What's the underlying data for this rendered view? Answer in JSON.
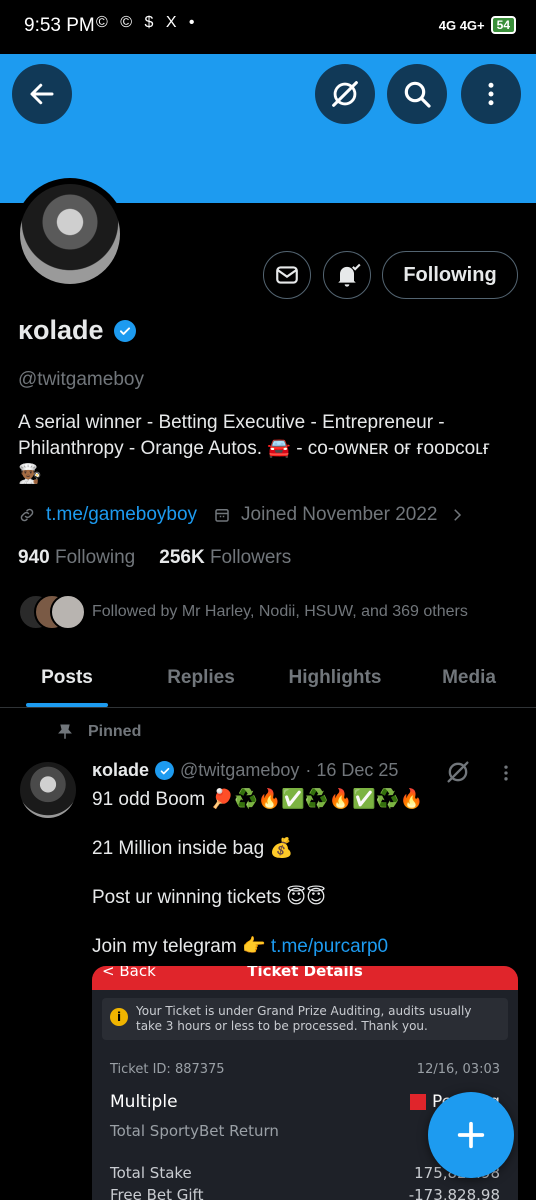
{
  "status": {
    "time": "9:53 PM",
    "app_icons": "© © $ X •",
    "network": "4G 4G+",
    "battery": "54"
  },
  "header": {
    "back_icon": "arrow-left-icon",
    "grok_icon": "slashed-circle-icon",
    "search_icon": "search-icon",
    "more_icon": "more-vertical-icon",
    "banner_color": "#1d9bf0"
  },
  "profile": {
    "name": "ĸolade",
    "handle": "@twitgameboy",
    "bio": "A serial winner - Betting Executive - Entrepreneur - Philanthropy - Orange Autos. 🚘 - ᴄᴏ-ᴏᴡɴᴇʀ ᴏғ ғᴏᴏᴅᴄᴏʟғ 👨🏾‍🍳",
    "link": "t.me/gameboyboy",
    "joined": "Joined November 2022",
    "following_count": "940",
    "following_label": "Following",
    "followers_count": "256K",
    "followers_label": "Followers",
    "followed_by": "Followed by Mr Harley, Nodii, HSUW, and 369 others",
    "follow_button": "Following"
  },
  "tabs": [
    "Posts",
    "Replies",
    "Highlights",
    "Media"
  ],
  "post": {
    "pinned_label": "Pinned",
    "name": "ĸolade",
    "handle": "@twitgameboy",
    "date": "· 16 Dec 25",
    "line1": "91 odd Boom 🏓♻️🔥✅♻️🔥✅♻️🔥",
    "line2": "21 Million inside bag 💰",
    "line3": "Post ur winning tickets 😇😇",
    "line4_prefix": "Join my telegram 👉 ",
    "line4_link": "t.me/purcarp0"
  },
  "ticket": {
    "back": "< Back",
    "title": "Ticket Details",
    "notice": "Your Ticket is under Grand Prize Auditing, audits usually take 3 hours or less to be processed. Thank you.",
    "ticket_id": "Ticket ID: 887375",
    "datetime": "12/16, 03:03",
    "bet_type": "Multiple",
    "status": "Pending",
    "return_label": "Total SportyBet Return",
    "stake_label": "Total Stake",
    "stake_value": "175,828.98",
    "gift_label": "Free Bet Gift",
    "gift_value": "-173,828.98"
  },
  "fab_icon": "plus-icon"
}
